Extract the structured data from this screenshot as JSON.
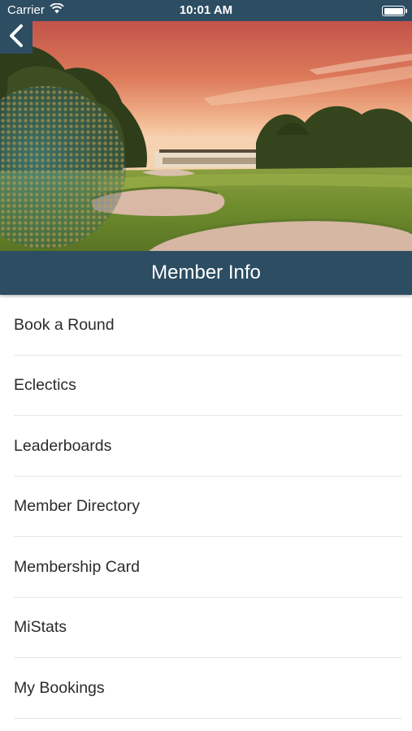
{
  "status_bar": {
    "carrier": "Carrier",
    "time": "10:01 AM",
    "wifi_icon": "wifi-icon",
    "battery_icon": "battery-full-icon"
  },
  "nav": {
    "back_icon": "chevron-left-icon"
  },
  "header": {
    "title": "Member Info"
  },
  "menu": {
    "items": [
      {
        "label": "Book a Round"
      },
      {
        "label": "Eclectics"
      },
      {
        "label": "Leaderboards"
      },
      {
        "label": "Member Directory"
      },
      {
        "label": "Membership Card"
      },
      {
        "label": "MiStats"
      },
      {
        "label": "My Bookings"
      }
    ]
  },
  "colors": {
    "brand_bar": "#2c4d62",
    "text": "#2b2b2b",
    "divider": "#e6e6e6"
  }
}
